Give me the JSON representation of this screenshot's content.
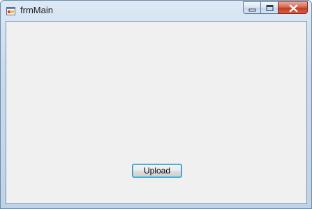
{
  "window": {
    "title": "frmMain",
    "app_icon": "form-icon"
  },
  "titlebar_controls": [
    {
      "name": "minimize",
      "icon": "minimize-icon"
    },
    {
      "name": "maximize",
      "icon": "maximize-icon"
    },
    {
      "name": "close",
      "icon": "close-icon"
    }
  ],
  "form": {
    "upload_label": "Upload"
  }
}
